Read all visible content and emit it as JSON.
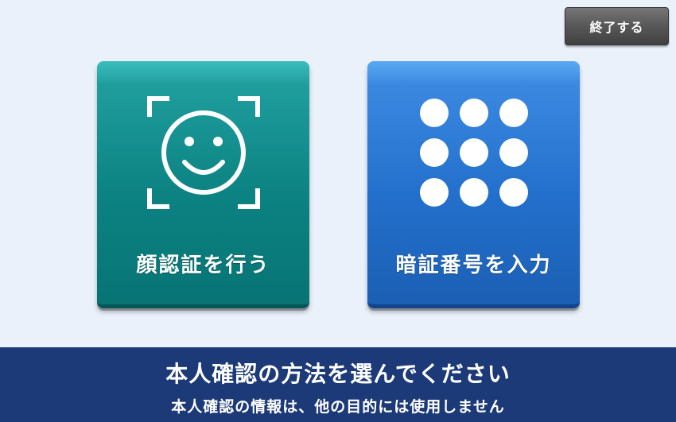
{
  "header": {
    "exit_label": "終了する"
  },
  "options": [
    {
      "label": "顔認証を行う",
      "icon": "face-scan-icon",
      "color": "#0c8282"
    },
    {
      "label": "暗証番号を入力",
      "icon": "keypad-icon",
      "color": "#2370cc"
    }
  ],
  "footer": {
    "instruction": "本人確認の方法を選んでください",
    "notice": "本人確認の情報は、他の目的には使用しません"
  },
  "colors": {
    "background": "#eaf1fb",
    "footer": "#1d3a78",
    "exit_button": "#5a5a5a"
  }
}
